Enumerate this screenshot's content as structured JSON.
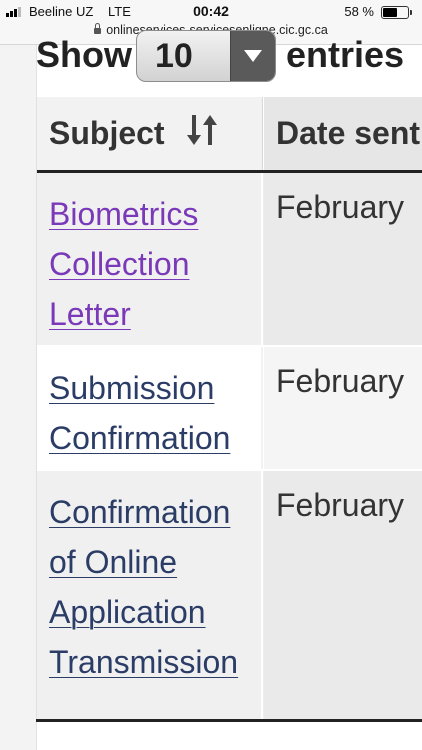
{
  "status_bar": {
    "carrier": "Beeline UZ",
    "network": "LTE",
    "time": "00:42",
    "battery_percent": "58 %",
    "battery_level": 0.58,
    "signal_bars": 3
  },
  "browser": {
    "url": "onlineservices-servicesenligne.cic.gc.ca"
  },
  "table_length": {
    "show_label": "Show",
    "selected_value": "10",
    "entries_label": "entries"
  },
  "table": {
    "columns": [
      {
        "label": "Subject"
      },
      {
        "label": "Date sent"
      }
    ],
    "rows": [
      {
        "subject": "Biometrics\nCollection\nLetter",
        "date": "February",
        "visited": true
      },
      {
        "subject": "Submission\nConfirmation",
        "date": "February",
        "visited": false
      },
      {
        "subject": "Confirmation\nof Online\nApplication\nTransmission",
        "date": "February",
        "visited": false
      }
    ]
  },
  "colors": {
    "visited_link": "#7a39b8",
    "link": "#2b3d66"
  }
}
